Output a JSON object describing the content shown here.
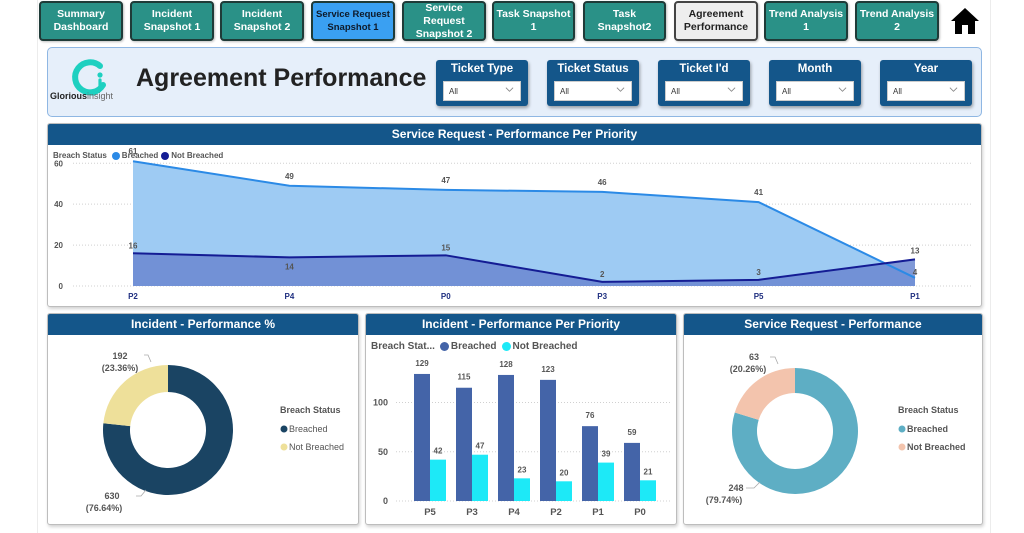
{
  "nav": {
    "buttons": [
      {
        "label": "Summary Dashboard",
        "line1": "Summary",
        "line2": "Dashboard",
        "state": "default"
      },
      {
        "label": "Incident Snapshot 1",
        "line1": "Incident",
        "line2": "Snapshot 1",
        "state": "default"
      },
      {
        "label": "Incident Snapshot 2",
        "line1": "Incident",
        "line2": "Snapshot 2",
        "state": "default"
      },
      {
        "label": "Service Request Snapshot 1",
        "line1": "Service Request",
        "line2": "Snapshot 1",
        "state": "highlighted"
      },
      {
        "label": "Service Request Snapshot 2",
        "line1": "Service Request",
        "line2": "Snapshot 2",
        "state": "default"
      },
      {
        "label": "Task Snapshot 1",
        "line1": "Task Snapshot 1",
        "line2": "",
        "state": "default"
      },
      {
        "label": "Task Snapshot2",
        "line1": "Task Snapshot2",
        "line2": "",
        "state": "default"
      },
      {
        "label": "Agreement Performance",
        "line1": "Agreement",
        "line2": "Performance",
        "state": "current"
      },
      {
        "label": "Trend Analysis 1",
        "line1": "Trend Analysis 1",
        "line2": "",
        "state": "default"
      },
      {
        "label": "Trend Analysis 2",
        "line1": "Trend Analysis 2",
        "line2": "",
        "state": "default"
      }
    ],
    "home_icon": "home-icon"
  },
  "header": {
    "logo_brand": "Glorious",
    "logo_suffix": "insight",
    "title": "Agreement Performance",
    "slicers": [
      {
        "label": "Ticket Type",
        "value": "All"
      },
      {
        "label": "Ticket Status",
        "value": "All"
      },
      {
        "label": "Ticket I'd",
        "value": "All"
      },
      {
        "label": "Month",
        "value": "All"
      },
      {
        "label": "Year",
        "value": "All"
      }
    ]
  },
  "colors": {
    "nav_default": "#2a9187",
    "nav_highlight": "#3aa0f2",
    "panel_header": "#14568a",
    "sr_breached": "#2b8ae6",
    "sr_breached_fill": "#9ecbf3",
    "sr_not_breached": "#141c94",
    "sr_not_breached_fill": "#6a87d0",
    "inc_breached": "#1a4463",
    "inc_not_breached": "#eee09a",
    "bar_breached": "#4464a8",
    "bar_not_breached": "#1de9f7",
    "srp_breached": "#5eaec4",
    "srp_not_breached": "#f3c4ad"
  },
  "chart_data": [
    {
      "id": "sr-per-priority",
      "type": "area",
      "title": "Service Request - Performance Per Priority",
      "legend_title": "Breach Status",
      "legend_position": "top-left",
      "categories": [
        "P2",
        "P4",
        "P0",
        "P3",
        "P5",
        "P1"
      ],
      "series": [
        {
          "name": "Breached",
          "values": [
            61,
            49,
            47,
            46,
            41,
            4
          ]
        },
        {
          "name": "Not Breached",
          "values": [
            16,
            14,
            15,
            2,
            3,
            13
          ]
        }
      ],
      "y_ticks": [
        0,
        20,
        40,
        60
      ],
      "ylim": [
        0,
        66
      ],
      "grid": true
    },
    {
      "id": "incident-performance-pct",
      "type": "pie",
      "donut": true,
      "title": "Incident - Performance %",
      "legend_title": "Breach Status",
      "legend_position": "right",
      "slices": [
        {
          "name": "Breached",
          "value": 630,
          "pct": "76.64%"
        },
        {
          "name": "Not Breached",
          "value": 192,
          "pct": "23.36%"
        }
      ]
    },
    {
      "id": "incident-per-priority",
      "type": "bar",
      "title": "Incident - Performance Per Priority",
      "legend_title": "Breach Stat...",
      "legend_position": "top-left",
      "categories": [
        "P5",
        "P3",
        "P4",
        "P2",
        "P1",
        "P0"
      ],
      "series": [
        {
          "name": "Breached",
          "values": [
            129,
            115,
            128,
            123,
            76,
            59
          ]
        },
        {
          "name": "Not Breached",
          "values": [
            42,
            47,
            23,
            20,
            39,
            21
          ]
        }
      ],
      "y_ticks": [
        0,
        50,
        100
      ],
      "ylim": [
        0,
        132
      ],
      "grid": true
    },
    {
      "id": "sr-performance",
      "type": "pie",
      "donut": true,
      "title": "Service Request - Performance",
      "legend_title": "Breach Status",
      "legend_position": "right",
      "slices": [
        {
          "name": "Breached",
          "value": 248,
          "pct": "79.74%"
        },
        {
          "name": "Not Breached",
          "value": 63,
          "pct": "20.26%"
        }
      ]
    }
  ]
}
